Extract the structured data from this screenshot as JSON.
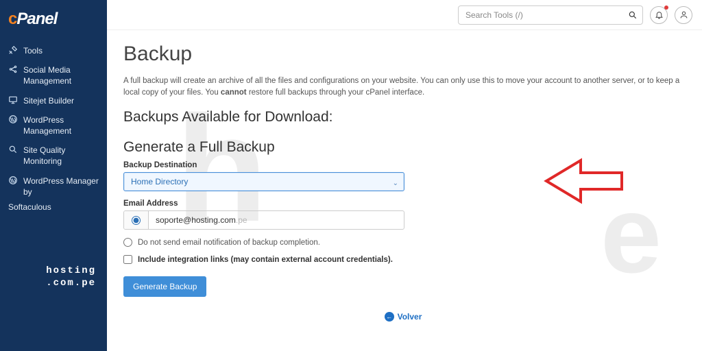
{
  "brand": {
    "name": "cPanel"
  },
  "sidebar": {
    "items": [
      {
        "label": "Tools"
      },
      {
        "label": "Social Media Management"
      },
      {
        "label": "Sitejet Builder"
      },
      {
        "label": "WordPress Management"
      },
      {
        "label": "Site Quality Monitoring"
      },
      {
        "label": "WordPress Manager by"
      }
    ],
    "extra": "Softaculous",
    "footer_line1": "hosting",
    "footer_line2": ".com.pe"
  },
  "topbar": {
    "search_placeholder": "Search Tools (/)"
  },
  "page": {
    "title": "Backup",
    "desc_pre": "A full backup will create an archive of all the files and configurations on your website. You can only use this to move your account to another server, or to keep a local copy of your files. You ",
    "desc_bold": "cannot",
    "desc_post": " restore full backups through your cPanel interface.",
    "section_downloads": "Backups Available for Download:",
    "section_generate": "Generate a Full Backup",
    "dest_label": "Backup Destination",
    "dest_value": "Home Directory",
    "email_label": "Email Address",
    "email_value": "soporte@hosting.com",
    "email_suffix": ".pe",
    "no_email_label": "Do not send email notification of backup completion.",
    "include_label": "Include integration links (may contain external account credentials).",
    "generate_btn": "Generate Backup",
    "back_text": "Volver"
  }
}
